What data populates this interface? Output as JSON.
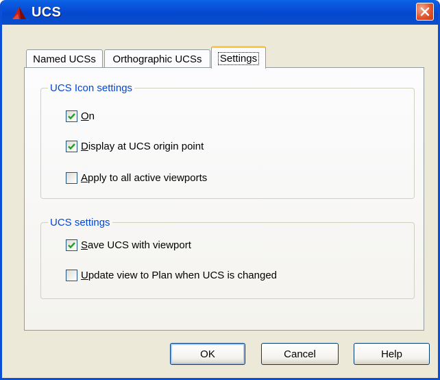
{
  "window": {
    "title": "UCS",
    "icons": {
      "app": "autocad-logo-icon",
      "close": "close-icon"
    }
  },
  "tabs": [
    {
      "label": "Named UCSs",
      "active": false
    },
    {
      "label": "Orthographic UCSs",
      "active": false
    },
    {
      "label": "Settings",
      "active": true
    }
  ],
  "ucs_icon_settings": {
    "legend": "UCS Icon settings",
    "on": {
      "mnemonic": "O",
      "rest": "n",
      "checked": true
    },
    "display_at_origin": {
      "mnemonic": "D",
      "rest": "isplay at UCS origin point",
      "checked": true
    },
    "apply_to_all": {
      "mnemonic": "A",
      "rest": "pply to all active viewports",
      "checked": false
    }
  },
  "ucs_settings": {
    "legend": "UCS settings",
    "save_with_viewport": {
      "mnemonic": "S",
      "rest": "ave UCS with viewport",
      "checked": true
    },
    "update_view_to_plan": {
      "mnemonic": "U",
      "rest": "pdate view to Plan when UCS is changed",
      "checked": false
    }
  },
  "buttons": {
    "ok": "OK",
    "cancel": "Cancel",
    "help": "Help"
  },
  "colors": {
    "titlebar": "#0a4fd6",
    "close": "#e0512a",
    "legend": "#0046d5",
    "active_tab_accent": "#ffc83c",
    "check": "#21a121"
  }
}
